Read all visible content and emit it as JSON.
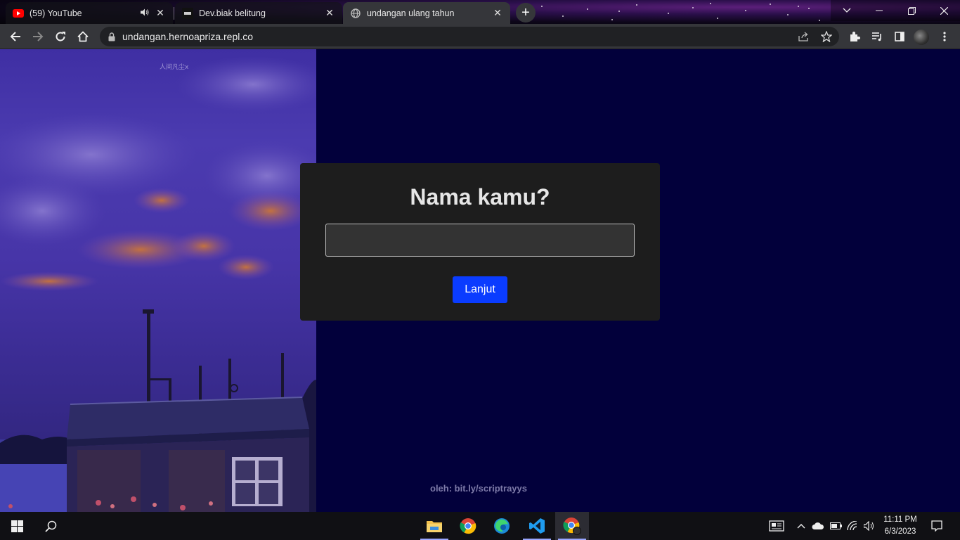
{
  "browser": {
    "tabs": [
      {
        "title": "(59) YouTube",
        "favicon": "youtube-icon",
        "audio": true
      },
      {
        "title": "Dev.biak belitung",
        "favicon": "biak-icon"
      },
      {
        "title": "undangan ulang tahun",
        "favicon": "globe-icon",
        "active": true
      }
    ],
    "url": "undangan.hernoapriza.repl.co"
  },
  "page": {
    "heading": "Nama kamu?",
    "name_input": {
      "value": "",
      "placeholder": ""
    },
    "continue_label": "Lanjut",
    "footer": "oleh: bit.ly/scriptrayys",
    "image_watermark": "人间凡尘x"
  },
  "taskbar": {
    "apps": [
      "file-explorer-icon",
      "chrome-icon",
      "edge-icon",
      "vscode-icon",
      "chrome-profile-icon"
    ],
    "time": "11:11 PM",
    "date": "6/3/2023"
  },
  "colors": {
    "page_background": "#02003b",
    "card_background": "#1d1d1d",
    "button": "#0a3cff",
    "footer_text": "#7d7aa8"
  }
}
